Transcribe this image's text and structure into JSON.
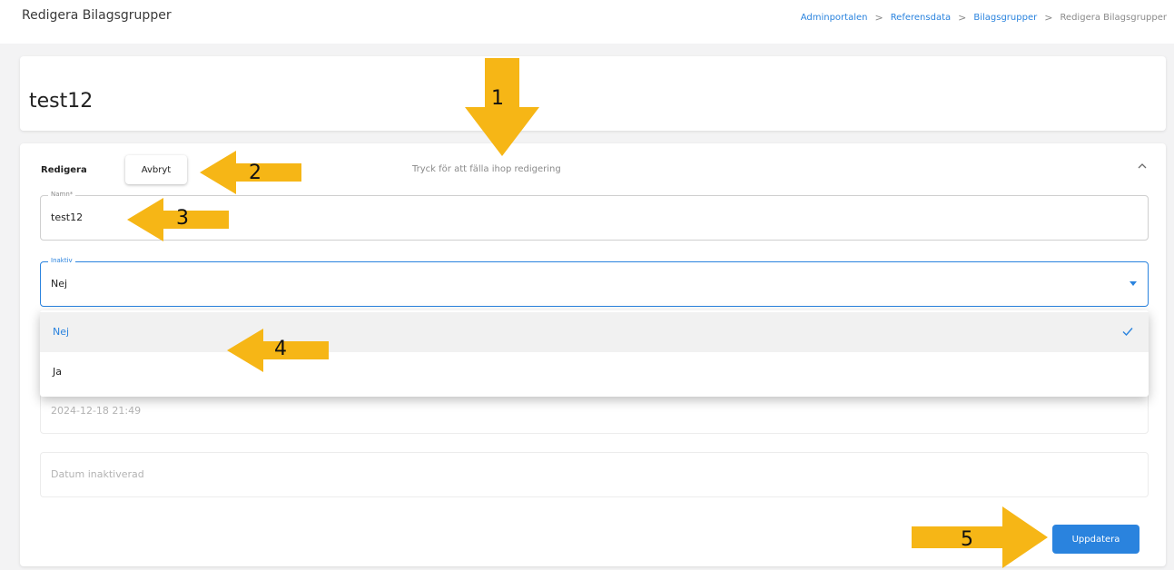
{
  "header": {
    "page_title": "Redigera Bilagsgrupper",
    "breadcrumb": [
      "Adminportalen",
      "Referensdata",
      "Bilagsgrupper",
      "Redigera Bilagsgrupper"
    ],
    "breadcrumb_separator": ">"
  },
  "record": {
    "title": "test12"
  },
  "edit_panel": {
    "label": "Redigera",
    "cancel_label": "Avbryt",
    "collapse_hint": "Tryck för att fälla ihop redigering",
    "fields": {
      "name": {
        "legend": "Namn*",
        "value": "test12"
      },
      "inactive": {
        "legend": "Inaktiv",
        "value": "Nej"
      },
      "created": {
        "value": "2024-12-18 21:49"
      },
      "deactivated": {
        "placeholder": "Datum inaktiverad"
      }
    },
    "update_label": "Uppdatera"
  },
  "dropdown": {
    "options": [
      {
        "label": "Nej",
        "selected": true
      },
      {
        "label": "Ja",
        "selected": false
      }
    ]
  },
  "annotations": [
    "1",
    "2",
    "3",
    "4",
    "5"
  ],
  "colors": {
    "accent": "#2a83de",
    "annotation_arrow": "#f6b616"
  },
  "icons": [
    "chevron-up-icon",
    "dropdown-caret-icon",
    "check-icon"
  ]
}
